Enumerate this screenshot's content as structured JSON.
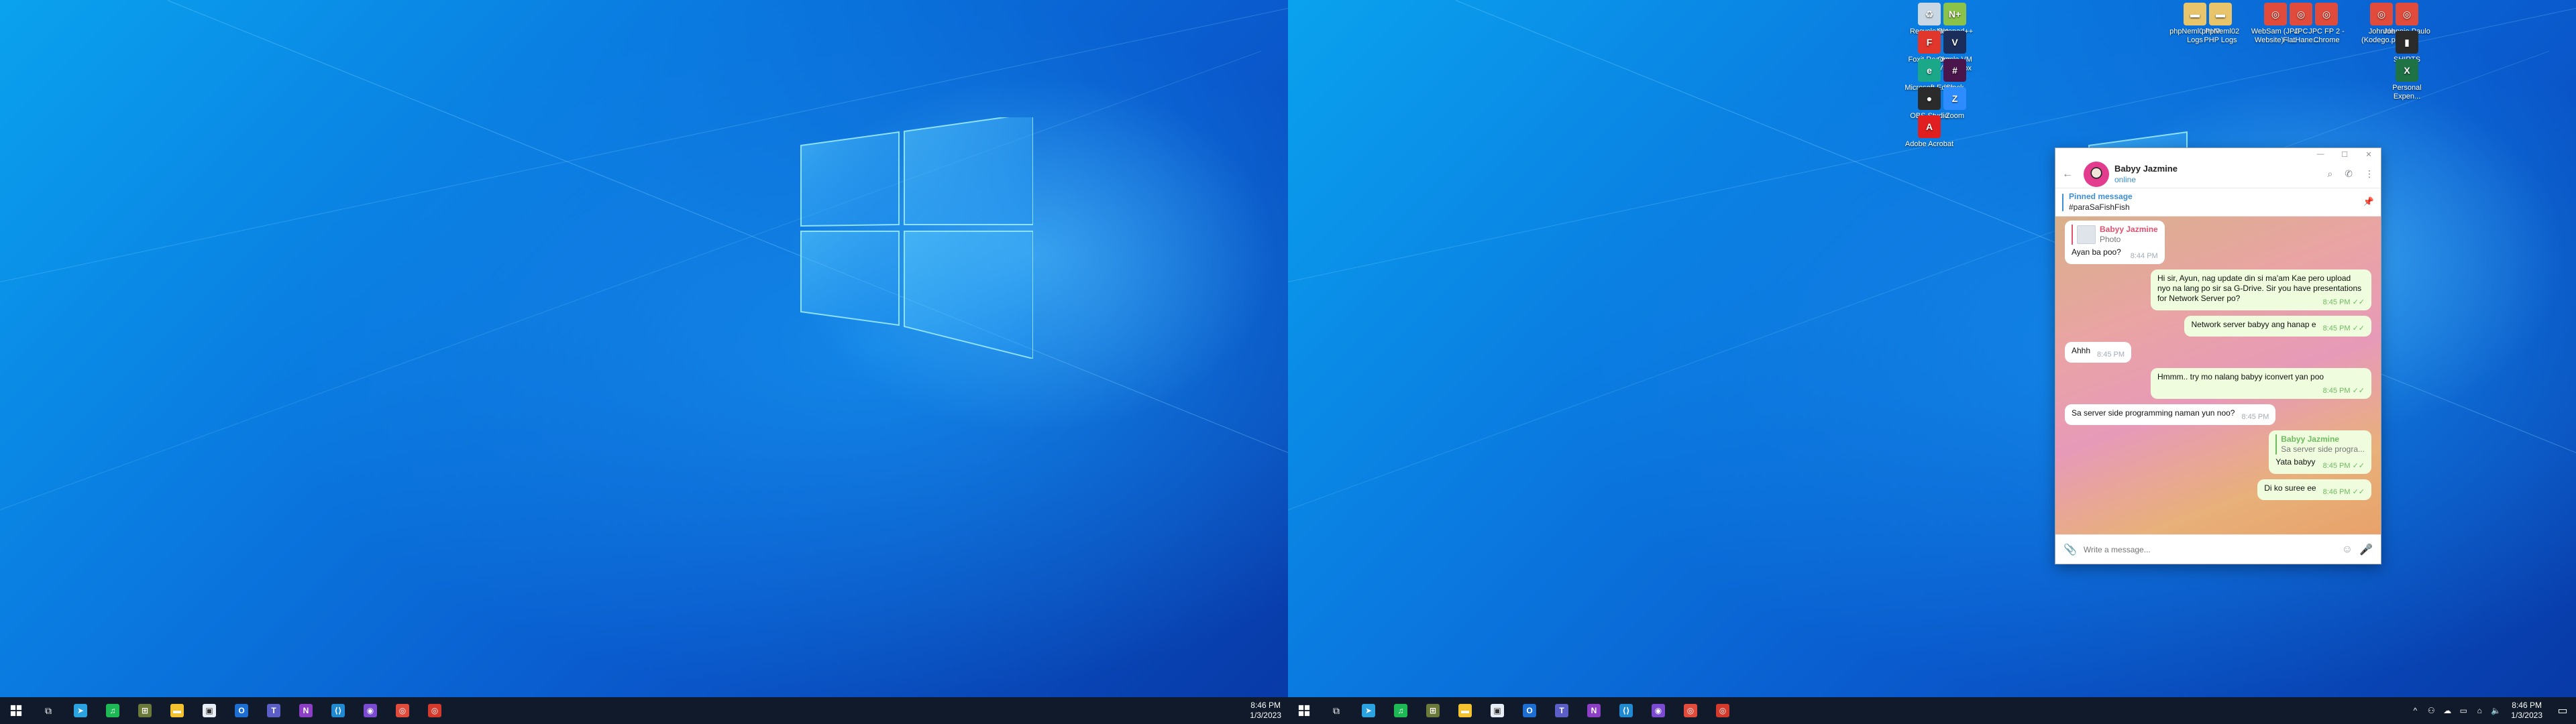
{
  "left_monitor": {
    "taskbar": {
      "apps": [
        {
          "icon": "telegram-icon",
          "color": "#2aa3e0",
          "glyph": "➤"
        },
        {
          "icon": "spotify-icon",
          "color": "#1db954",
          "glyph": "♫"
        },
        {
          "icon": "calculator-icon",
          "color": "#6b7a3a",
          "glyph": "⊞"
        },
        {
          "icon": "file-explorer-icon",
          "color": "#f2c230",
          "glyph": "▬"
        },
        {
          "icon": "store-icon",
          "color": "#e8eef5",
          "glyph": "▣"
        },
        {
          "icon": "outlook-icon",
          "color": "#1c6fd0",
          "glyph": "O"
        },
        {
          "icon": "teams-icon",
          "color": "#5a5fc8",
          "glyph": "T"
        },
        {
          "icon": "onenote-icon",
          "color": "#8c3fc4",
          "glyph": "N"
        },
        {
          "icon": "vscode-icon",
          "color": "#1f8ad2",
          "glyph": "⟨⟩"
        },
        {
          "icon": "github-desktop-icon",
          "color": "#7a4bd1",
          "glyph": "◉"
        },
        {
          "icon": "chrome-icon",
          "color": "#e04b3b",
          "glyph": "◎"
        },
        {
          "icon": "chrome-user-icon",
          "color": "#d33a2c",
          "glyph": "◎"
        }
      ],
      "clock": {
        "time": "8:46 PM",
        "date": "1/3/2023"
      }
    }
  },
  "right_monitor": {
    "desktop_icons": [
      {
        "label": "Recycle Bin",
        "icon": "recycle-bin-icon",
        "color": "#c9d6e3",
        "glyph": "♻"
      },
      {
        "label": "Notepad++",
        "icon": "notepadpp-icon",
        "color": "#8bc34a",
        "glyph": "N+"
      },
      {
        "label": "Foxit Reader",
        "icon": "foxit-reader-icon",
        "color": "#e0362b",
        "glyph": "F"
      },
      {
        "label": "Oracle VM VirtualBox",
        "icon": "virtualbox-icon",
        "color": "#1b2d5a",
        "glyph": "V"
      },
      {
        "label": "Microsoft Edge",
        "icon": "edge-icon",
        "color": "#1aa889",
        "glyph": "e"
      },
      {
        "label": "Slack",
        "icon": "slack-icon",
        "color": "#4a154b",
        "glyph": "#"
      },
      {
        "label": "OBS Studio",
        "icon": "obs-studio-icon",
        "color": "#2b2b2b",
        "glyph": "●"
      },
      {
        "label": "Zoom",
        "icon": "zoom-icon",
        "color": "#2d8cff",
        "glyph": "Z"
      },
      {
        "label": "Adobe Acrobat",
        "icon": "acrobat-icon",
        "color": "#e02020",
        "glyph": "A"
      },
      {
        "label": "phpNeml0 PHP Logs",
        "icon": "folder-icon-1",
        "color": "#e8c46b",
        "glyph": "▬"
      },
      {
        "label": "phpNeml02 PHP Logs",
        "icon": "folder-icon-2",
        "color": "#e8c46b",
        "glyph": "▬"
      },
      {
        "label": "WebSam (JPC Website) - ...",
        "icon": "chrome-shortcut-icon-1",
        "color": "#e04b3b",
        "glyph": "◎"
      },
      {
        "label": "JPC FlatHane...",
        "icon": "chrome-shortcut-icon-2",
        "color": "#e04b3b",
        "glyph": "◎"
      },
      {
        "label": "JPC FP 2 - Chrome",
        "icon": "chrome-shortcut-icon-3",
        "color": "#e04b3b",
        "glyph": "◎"
      },
      {
        "label": "Johnnie (Kodego.p...",
        "icon": "chrome-shortcut-icon-4",
        "color": "#e04b3b",
        "glyph": "◎"
      },
      {
        "label": "Johnnie Paulo (JP...",
        "icon": "chrome-shortcut-icon-5",
        "color": "#e04b3b",
        "glyph": "◎"
      },
      {
        "label": "SHIRTS",
        "icon": "shirts-file-icon",
        "color": "#2b2b2b",
        "glyph": "▮"
      },
      {
        "label": "Personal Expen...",
        "icon": "excel-file-icon",
        "color": "#1f7244",
        "glyph": "X"
      }
    ],
    "telegram": {
      "contact_name": "Babyy Jazmine",
      "contact_status": "online",
      "pinned_label": "Pinned message",
      "pinned_text": "#paraSaFishFish",
      "messages": [
        {
          "dir": "in",
          "reply_name": "Babyy Jazmine",
          "reply_text": "Photo",
          "reply_photo": true,
          "text": "Ayan ba poo?",
          "time": "8:44 PM"
        },
        {
          "dir": "out",
          "text": "Hi sir, Ayun, nag update din si ma'am Kae pero upload nyo na lang po sir sa G-Drive. Sir you have presentations for Network Server po?",
          "time": "8:45 PM"
        },
        {
          "dir": "out",
          "text": "Network server babyy ang hanap e",
          "time": "8:45 PM"
        },
        {
          "dir": "in",
          "text": "Ahhh",
          "time": "8:45 PM"
        },
        {
          "dir": "out",
          "text": "Hmmm.. try mo nalang babyy iconvert yan poo",
          "time": "8:45 PM"
        },
        {
          "dir": "in",
          "text": "Sa server side programming naman yun noo?",
          "time": "8:45 PM"
        },
        {
          "dir": "out",
          "reply_name": "Babyy Jazmine",
          "reply_text": "Sa server side progra...",
          "text": "Yata babyy",
          "time": "8:45 PM"
        },
        {
          "dir": "out",
          "text": "Di ko suree ee",
          "time": "8:46 PM"
        }
      ],
      "input_placeholder": "Write a message..."
    },
    "taskbar": {
      "clock": {
        "time": "8:46 PM",
        "date": "1/3/2023"
      }
    }
  }
}
